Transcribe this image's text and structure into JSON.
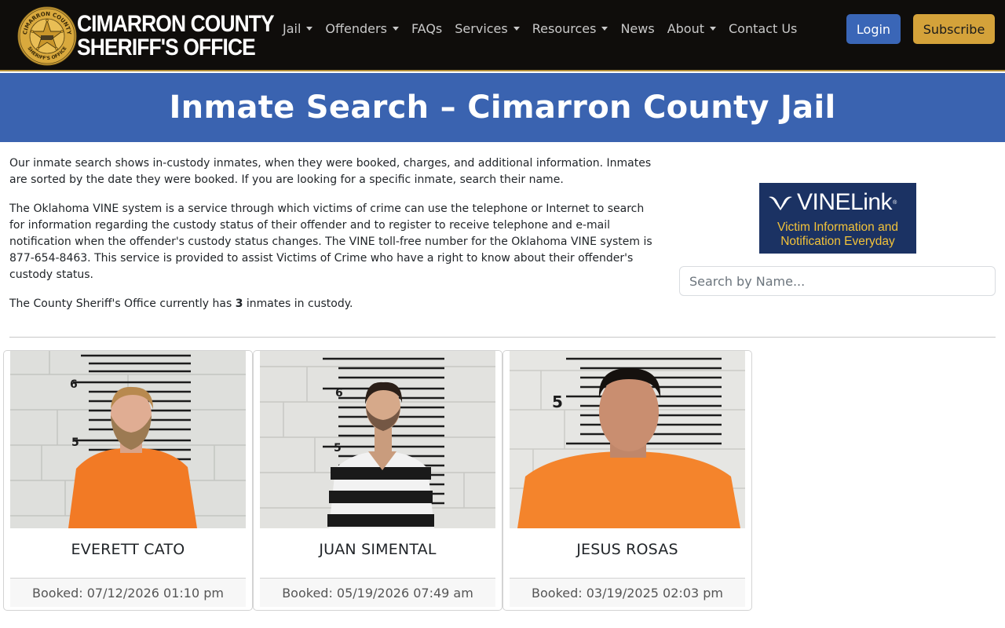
{
  "brand": {
    "line1": "CIMARRON COUNTY",
    "line2": "SHERIFF'S OFFICE",
    "seal_icon": "sheriff-star-badge-icon",
    "seal_ring_text_top": "CIMARRON COUNTY",
    "seal_ring_text_bottom": "SHERIFF'S OFFICE"
  },
  "nav": {
    "items": [
      {
        "label": "Jail",
        "dropdown": true
      },
      {
        "label": "Offenders",
        "dropdown": true
      },
      {
        "label": "FAQs",
        "dropdown": false
      },
      {
        "label": "Services",
        "dropdown": true
      },
      {
        "label": "Resources",
        "dropdown": true
      },
      {
        "label": "News",
        "dropdown": false
      },
      {
        "label": "About",
        "dropdown": true
      },
      {
        "label": "Contact Us",
        "dropdown": false
      }
    ],
    "login_label": "Login",
    "subscribe_label": "Subscribe"
  },
  "hero": {
    "title": "Inmate Search – Cimarron County Jail"
  },
  "intro": {
    "p1": "Our inmate search shows in-custody inmates, when they were booked, charges, and additional information. Inmates are sorted by the date they were booked. If you are looking for a specific inmate, search their name.",
    "p2": "The Oklahoma VINE system is a service through which victims of crime can use the telephone or Internet to search for information regarding the custody status of their offender and to register to receive telephone and e-mail notification when the offender's custody status changes. The VINE toll-free number for the Oklahoma VINE system is 877-654-8463. This service is provided to assist Victims of Crime who have a right to know about their offender's custody status.",
    "p3_before": "The County Sheriff's Office currently has ",
    "p3_count": "3",
    "p3_after": " inmates in custody."
  },
  "vine": {
    "logo_text": "VINELink",
    "registered": "®",
    "tagline_line1": "Victim Information and",
    "tagline_line2": "Notification Everyday"
  },
  "search": {
    "placeholder": "Search by Name..."
  },
  "inmates": [
    {
      "name": "EVERETT CATO",
      "booked": "Booked: 07/12/2026 01:10 pm",
      "uniform": "orange"
    },
    {
      "name": "JUAN SIMENTAL",
      "booked": "Booked: 05/19/2026 07:49 am",
      "uniform": "black-white-stripes"
    },
    {
      "name": "JESUS ROSAS",
      "booked": "Booked: 03/19/2025 02:03 pm",
      "uniform": "orange"
    }
  ],
  "colors": {
    "navbar_bg": "#0f0d0b",
    "hero_bg": "#3a63b0",
    "login_bg": "#3a66b7",
    "subscribe_bg": "#d4a23a",
    "vine_bg": "#1b3263",
    "vine_tagline": "#f2c23a"
  }
}
